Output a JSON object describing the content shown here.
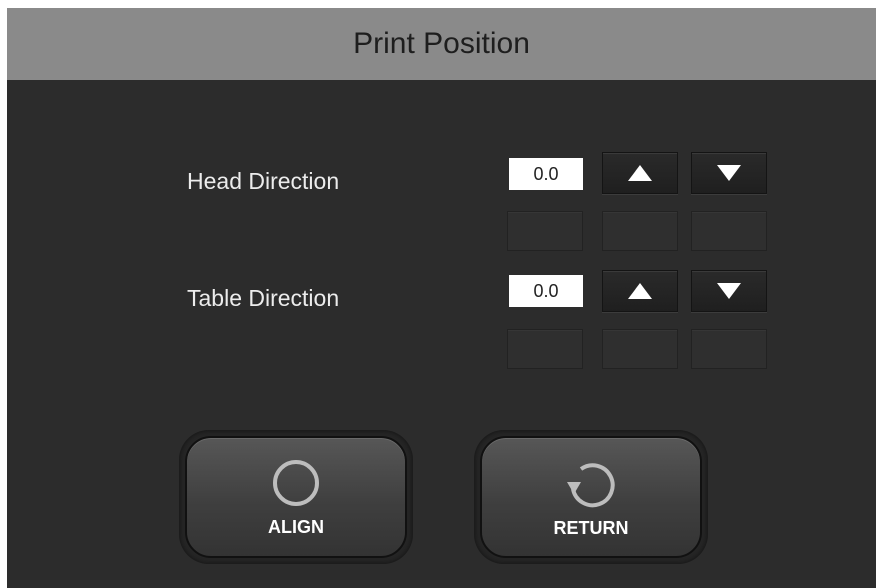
{
  "title": "Print Position",
  "rows": [
    {
      "label": "Head Direction",
      "value": "0.0"
    },
    {
      "label": "Table Direction",
      "value": "0.0"
    }
  ],
  "buttons": {
    "align": {
      "label": "ALIGN",
      "icon": "circle-icon"
    },
    "return": {
      "label": "RETURN",
      "icon": "rotate-icon"
    }
  },
  "colors": {
    "background": "#2c2c2c",
    "title_bar": "#8a8a8a",
    "label_text": "#ececec"
  }
}
